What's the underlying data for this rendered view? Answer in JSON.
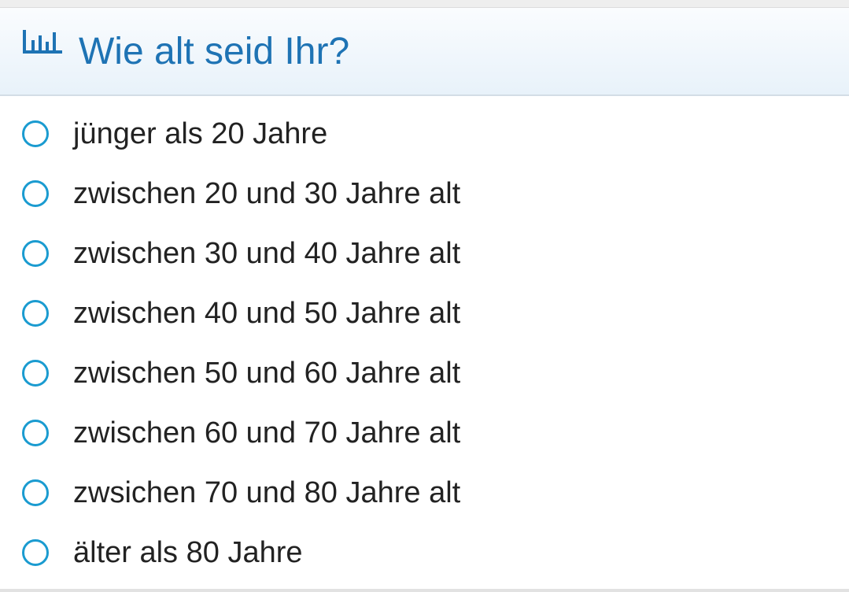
{
  "poll": {
    "icon": "bar-chart-icon",
    "title": "Wie alt seid Ihr?",
    "options": [
      {
        "label": "jünger als 20 Jahre",
        "selected": false
      },
      {
        "label": "zwischen 20 und 30 Jahre alt",
        "selected": false
      },
      {
        "label": "zwischen 30 und 40 Jahre alt",
        "selected": false
      },
      {
        "label": "zwischen 40 und 50 Jahre alt",
        "selected": false
      },
      {
        "label": "zwischen 50 und 60 Jahre alt",
        "selected": false
      },
      {
        "label": "zwischen 60 und 70 Jahre alt",
        "selected": false
      },
      {
        "label": "zwsichen 70 und 80 Jahre alt",
        "selected": false
      },
      {
        "label": "älter als 80 Jahre",
        "selected": false
      }
    ]
  },
  "colors": {
    "accent": "#1e73b4",
    "radio_border": "#1a9bd0",
    "text": "#222222"
  }
}
